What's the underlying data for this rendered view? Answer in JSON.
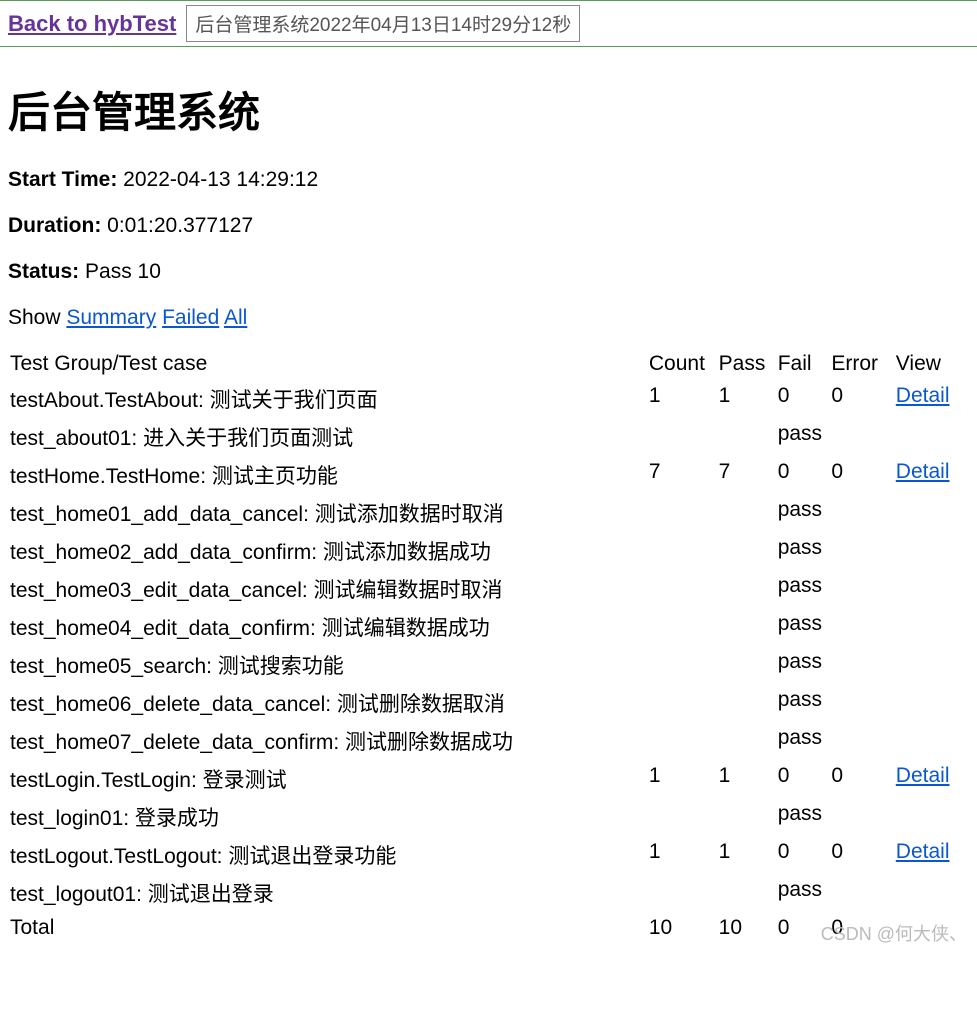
{
  "header": {
    "back_link": "Back to hybTest",
    "title_box": "后台管理系统2022年04月13日14时29分12秒"
  },
  "report": {
    "title": "后台管理系统",
    "start_label": "Start Time:",
    "start_value": "2022-04-13 14:29:12",
    "duration_label": "Duration:",
    "duration_value": "0:01:20.377127",
    "status_label": "Status:",
    "status_value": "Pass 10",
    "show_label": "Show",
    "filters": {
      "summary": "Summary",
      "failed": "Failed",
      "all": "All"
    }
  },
  "table": {
    "headers": {
      "name": "Test Group/Test case",
      "count": "Count",
      "pass": "Pass",
      "fail": "Fail",
      "error": "Error",
      "view": "View"
    },
    "detail_label": "Detail",
    "rows": [
      {
        "type": "group",
        "name": "testAbout.TestAbout: 测试关于我们页面",
        "count": "1",
        "pass": "1",
        "fail": "0",
        "error": "0",
        "view": true
      },
      {
        "type": "case",
        "name": "test_about01: 进入关于我们页面测试",
        "result": "pass"
      },
      {
        "type": "group",
        "name": "testHome.TestHome: 测试主页功能",
        "count": "7",
        "pass": "7",
        "fail": "0",
        "error": "0",
        "view": true
      },
      {
        "type": "case",
        "name": "test_home01_add_data_cancel: 测试添加数据时取消",
        "result": "pass"
      },
      {
        "type": "case",
        "name": "test_home02_add_data_confirm: 测试添加数据成功",
        "result": "pass"
      },
      {
        "type": "case",
        "name": "test_home03_edit_data_cancel: 测试编辑数据时取消",
        "result": "pass"
      },
      {
        "type": "case",
        "name": "test_home04_edit_data_confirm: 测试编辑数据成功",
        "result": "pass"
      },
      {
        "type": "case",
        "name": "test_home05_search: 测试搜索功能",
        "result": "pass"
      },
      {
        "type": "case",
        "name": "test_home06_delete_data_cancel: 测试删除数据取消",
        "result": "pass"
      },
      {
        "type": "case",
        "name": "test_home07_delete_data_confirm: 测试删除数据成功",
        "result": "pass"
      },
      {
        "type": "group",
        "name": "testLogin.TestLogin: 登录测试",
        "count": "1",
        "pass": "1",
        "fail": "0",
        "error": "0",
        "view": true
      },
      {
        "type": "case",
        "name": "test_login01: 登录成功",
        "result": "pass"
      },
      {
        "type": "group",
        "name": "testLogout.TestLogout: 测试退出登录功能",
        "count": "1",
        "pass": "1",
        "fail": "0",
        "error": "0",
        "view": true
      },
      {
        "type": "case",
        "name": "test_logout01: 测试退出登录",
        "result": "pass"
      },
      {
        "type": "total",
        "name": "Total",
        "count": "10",
        "pass": "10",
        "fail": "0",
        "error": "0"
      }
    ]
  },
  "watermark": "CSDN @何大侠、"
}
